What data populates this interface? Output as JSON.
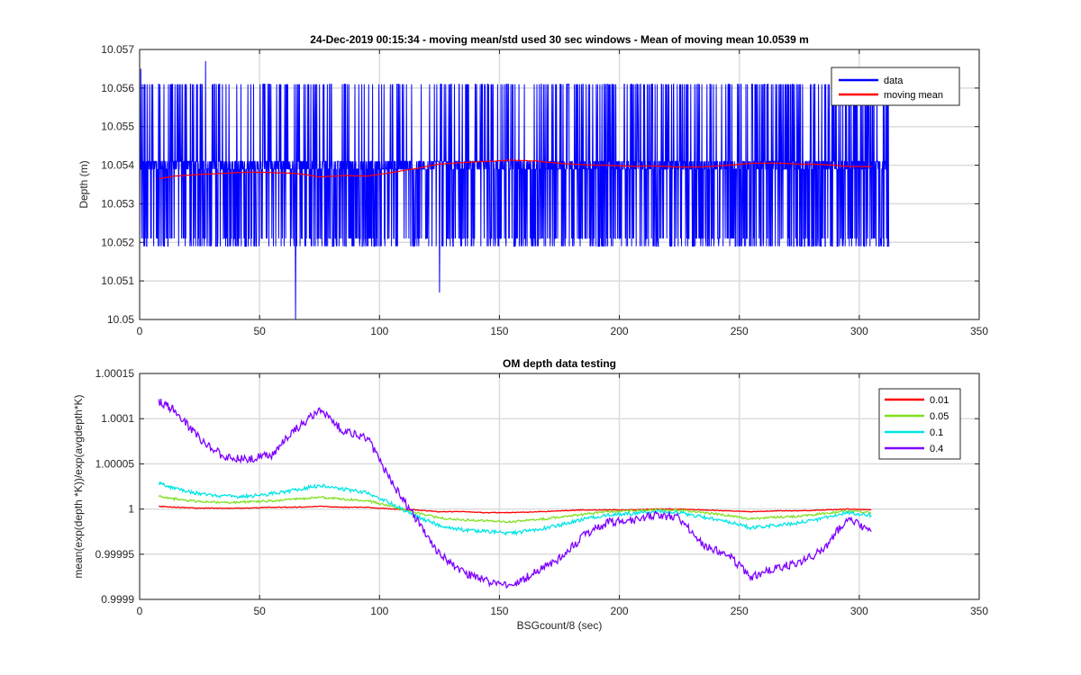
{
  "chart_data": [
    {
      "type": "line",
      "title": "24-Dec-2019 00:15:34 - moving mean/std used 30 sec windows - Mean of moving mean 10.0539 m",
      "xlabel": "",
      "ylabel": "Depth (m)",
      "xlim": [
        0,
        350
      ],
      "ylim": [
        10.05,
        10.057
      ],
      "xticks": [
        0,
        50,
        100,
        150,
        200,
        250,
        300,
        350
      ],
      "yticks": [
        10.05,
        10.051,
        10.052,
        10.053,
        10.054,
        10.055,
        10.056,
        10.057
      ],
      "ytick_labels": [
        "10.05",
        "10.051",
        "10.052",
        "10.053",
        "10.054",
        "10.055",
        "10.056",
        "10.057"
      ],
      "grid": true,
      "legend_position": "top-right",
      "series": [
        {
          "name": "data",
          "color": "#0000ff",
          "x_range": [
            0,
            312.5
          ],
          "typical_levels": [
            10.0519,
            10.0521,
            10.0539,
            10.0541,
            10.0561
          ],
          "spikes": [
            {
              "x": 0.5,
              "y": 10.0565
            },
            {
              "x": 27.5,
              "y": 10.0567
            },
            {
              "x": 65,
              "y": 10.05
            },
            {
              "x": 125,
              "y": 10.0507
            },
            {
              "x": 3,
              "y": 10.0519
            }
          ]
        },
        {
          "name": "moving mean",
          "color": "#ff0000",
          "x": [
            8,
            15,
            25,
            35,
            45,
            55,
            65,
            75,
            85,
            95,
            105,
            115,
            125,
            135,
            145,
            155,
            165,
            175,
            185,
            195,
            205,
            215,
            225,
            235,
            245,
            255,
            265,
            275,
            285,
            295,
            305
          ],
          "y": [
            10.05365,
            10.05372,
            10.05376,
            10.05379,
            10.05382,
            10.05381,
            10.05379,
            10.0537,
            10.05373,
            10.05372,
            10.05381,
            10.05391,
            10.05403,
            10.05407,
            10.0541,
            10.05413,
            10.05411,
            10.05405,
            10.05401,
            10.054,
            10.05397,
            10.05398,
            10.05395,
            10.05396,
            10.054,
            10.05405,
            10.05406,
            10.05403,
            10.05402,
            10.05397,
            10.05396
          ]
        }
      ]
    },
    {
      "type": "line",
      "title": "OM depth data testing",
      "xlabel": "BSGcount/8 (sec)",
      "ylabel": "mean(exp(depth *K))/exp(avgdepth*K)",
      "xlim": [
        0,
        350
      ],
      "ylim": [
        0.9999,
        1.00015
      ],
      "xticks": [
        0,
        50,
        100,
        150,
        200,
        250,
        300,
        350
      ],
      "yticks": [
        0.9999,
        0.99995,
        1,
        1.00005,
        1.0001,
        1.00015
      ],
      "ytick_labels": [
        "0.9999",
        "0.99995",
        "1",
        "1.00005",
        "1.0001",
        "1.00015"
      ],
      "grid": true,
      "legend_position": "top-right",
      "x": [
        8,
        15,
        25,
        35,
        45,
        55,
        65,
        75,
        85,
        95,
        105,
        115,
        125,
        135,
        145,
        155,
        165,
        175,
        185,
        195,
        205,
        215,
        225,
        235,
        245,
        255,
        265,
        275,
        285,
        295,
        305
      ],
      "series": [
        {
          "name": "0.01",
          "color": "#ff0000",
          "values": [
            1.000003,
            1.000002,
            1.000001,
            1.000001,
            1.000001,
            1.000002,
            1.000002,
            1.000003,
            1.000002,
            1.000002,
            1.0,
            0.999999,
            0.999997,
            0.999997,
            0.999996,
            0.999996,
            0.999997,
            0.999998,
            0.999999,
            0.999999,
            0.999999,
            1.0,
            1.0,
            0.999999,
            0.999998,
            0.999997,
            0.999998,
            0.999998,
            0.999999,
            1.0,
            0.999999
          ]
        },
        {
          "name": "0.05",
          "color": "#80e020",
          "values": [
            1.000014,
            1.000011,
            1.000008,
            1.000007,
            1.000008,
            1.000009,
            1.000011,
            1.000013,
            1.000011,
            1.000009,
            1.000003,
            0.999996,
            0.99999,
            0.999988,
            0.999987,
            0.999986,
            0.999988,
            0.999991,
            0.999994,
            0.999997,
            0.999998,
            0.999999,
            0.999999,
            0.999996,
            0.999993,
            0.999989,
            0.999991,
            0.999992,
            0.999995,
            0.999998,
            0.999996
          ]
        },
        {
          "name": "0.1",
          "color": "#00e5e5",
          "values": [
            1.000029,
            1.000022,
            1.000017,
            1.000014,
            1.000014,
            1.000017,
            1.000021,
            1.000026,
            1.000022,
            1.000018,
            1.000006,
            0.999992,
            0.999982,
            0.999977,
            0.999975,
            0.999973,
            0.999977,
            0.999982,
            0.999989,
            0.999994,
            0.999995,
            0.999997,
            0.999996,
            0.999991,
            0.999986,
            0.999979,
            0.999982,
            0.999985,
            0.99999,
            0.999996,
            0.999993
          ]
        },
        {
          "name": "0.4",
          "color": "#7f00ff",
          "values": [
            1.00012,
            1.000108,
            1.000078,
            1.000058,
            1.000055,
            1.00006,
            1.000088,
            1.00011,
            1.000086,
            1.000078,
            1.00003,
            0.99999,
            0.99995,
            0.99993,
            0.99992,
            0.999915,
            0.99993,
            0.999945,
            0.99997,
            0.999985,
            0.999988,
            0.999993,
            0.99999,
            0.99996,
            0.99995,
            0.999925,
            0.999935,
            0.99994,
            0.999955,
            0.99999,
            0.999975
          ]
        }
      ]
    }
  ]
}
